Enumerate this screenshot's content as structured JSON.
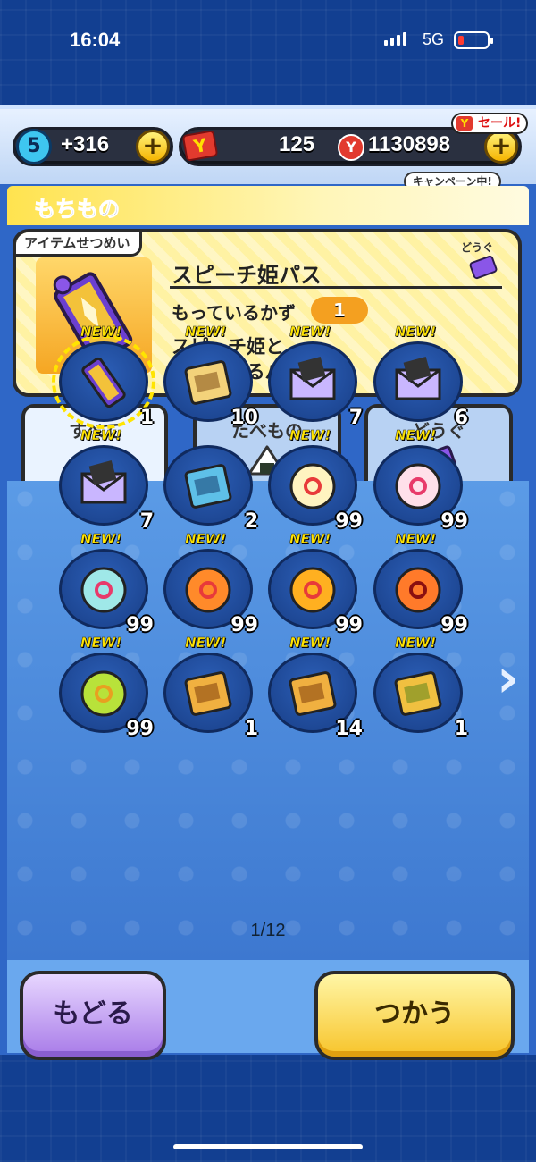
{
  "status": {
    "time": "16:04",
    "network": "5G"
  },
  "header": {
    "stamina_level": "5",
    "stamina_value": "+316",
    "ticket_value": "125",
    "money_value": "1130898",
    "sale_label": "セール!",
    "campaign_label": "キャンペーン中!",
    "ticket_icon": "Y",
    "coin_icon": "Y",
    "sale_icon": "Y",
    "plus_icon": "+"
  },
  "screen": {
    "title": "もちもの"
  },
  "info": {
    "tag": "アイテムせつめい",
    "name": "スピーチ姫パス",
    "count_label": "もっているかず",
    "count": "1",
    "description": "スピーチ姫と\n決闘できるパス",
    "category": "どうぐ"
  },
  "tabs": [
    {
      "label": "すべて",
      "icon": "bag-icon"
    },
    {
      "label": "たべもの",
      "icon": "onigiri-icon"
    },
    {
      "label": "どうぐ",
      "icon": "ticket-icon"
    }
  ],
  "items": [
    {
      "new": "NEW!",
      "count": "1",
      "icon": "pass-icon"
    },
    {
      "new": "NEW!",
      "count": "10",
      "icon": "scroll-icon"
    },
    {
      "new": "NEW!",
      "count": "7",
      "icon": "letter-3-icon"
    },
    {
      "new": "NEW!",
      "count": "6",
      "icon": "letter-4-icon"
    },
    {
      "new": "NEW!",
      "count": "7",
      "icon": "letter-5-icon"
    },
    {
      "new": "",
      "count": "2",
      "icon": "book-icon"
    },
    {
      "new": "NEW!",
      "count": "99",
      "icon": "orb-yellow-icon"
    },
    {
      "new": "NEW!",
      "count": "99",
      "icon": "orb-pink-icon"
    },
    {
      "new": "NEW!",
      "count": "99",
      "icon": "orb-cyan-icon"
    },
    {
      "new": "NEW!",
      "count": "99",
      "icon": "orb-orange-icon"
    },
    {
      "new": "NEW!",
      "count": "99",
      "icon": "orb-fire-icon"
    },
    {
      "new": "NEW!",
      "count": "99",
      "icon": "orb-shrine-icon"
    },
    {
      "new": "NEW!",
      "count": "99",
      "icon": "orb-golden-icon"
    },
    {
      "new": "NEW!",
      "count": "1",
      "icon": "book-gold-small-icon"
    },
    {
      "new": "NEW!",
      "count": "14",
      "icon": "book-gold-icon"
    },
    {
      "new": "NEW!",
      "count": "1",
      "icon": "book-bamboo-icon"
    }
  ],
  "pager": "1/12",
  "buttons": {
    "back": "もどる",
    "use": "つかう"
  },
  "next_arrow": "›",
  "colors": {
    "accent": "#ffe400",
    "panel": "#2f67c7",
    "back": "#a87be8",
    "use": "#f7c42a"
  }
}
